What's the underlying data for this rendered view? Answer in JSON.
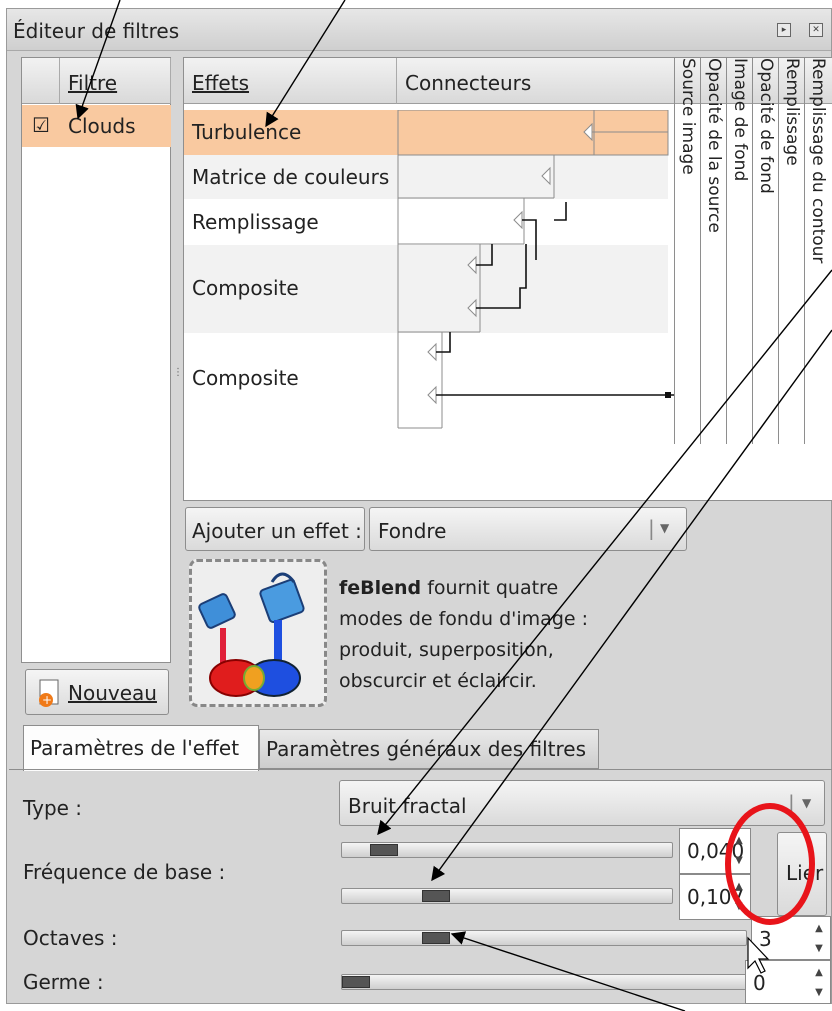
{
  "window": {
    "title": "Éditeur de filtres"
  },
  "filters": {
    "header": "Filtre",
    "items": [
      {
        "label": "Clouds",
        "checked": true,
        "check_glyph": "☑"
      }
    ],
    "new_button": "Nouveau"
  },
  "effects": {
    "header_effects": "Effets",
    "header_connectors": "Connecteurs",
    "rows": [
      {
        "label": "Turbulence"
      },
      {
        "label": "Matrice de couleurs"
      },
      {
        "label": "Remplissage"
      },
      {
        "label": "Composite"
      },
      {
        "label": "Composite"
      }
    ],
    "input_columns": [
      "Source image",
      "Opacité de la source",
      "Image de fond",
      "Opacité de fond",
      "Remplissage",
      "Remplissage du contour"
    ]
  },
  "add_effect": {
    "button": "Ajouter un effet :",
    "selected": "Fondre"
  },
  "description": {
    "name": "feBlend",
    "text_line1": " fournit quatre",
    "text_line2": "modes de fondu d'image :",
    "text_line3": "produit, superposition,",
    "text_line4": "obscurcir et éclaircir."
  },
  "tabs": [
    {
      "label": "Paramètres de l'effet",
      "active": true
    },
    {
      "label": "Paramètres généraux des filtres",
      "active": false
    }
  ],
  "params": {
    "type_label": "Type :",
    "type_value": "Bruit fractal",
    "freq_label": "Fréquence de base :",
    "freq_x": "0,040",
    "freq_y": "0,107",
    "link_button": "Lier",
    "octaves_label": "Octaves :",
    "octaves_value": "3",
    "seed_label": "Germe :",
    "seed_value": "0"
  },
  "colors": {
    "selection": "#f9c9a0",
    "annotation": "#e8141a"
  }
}
